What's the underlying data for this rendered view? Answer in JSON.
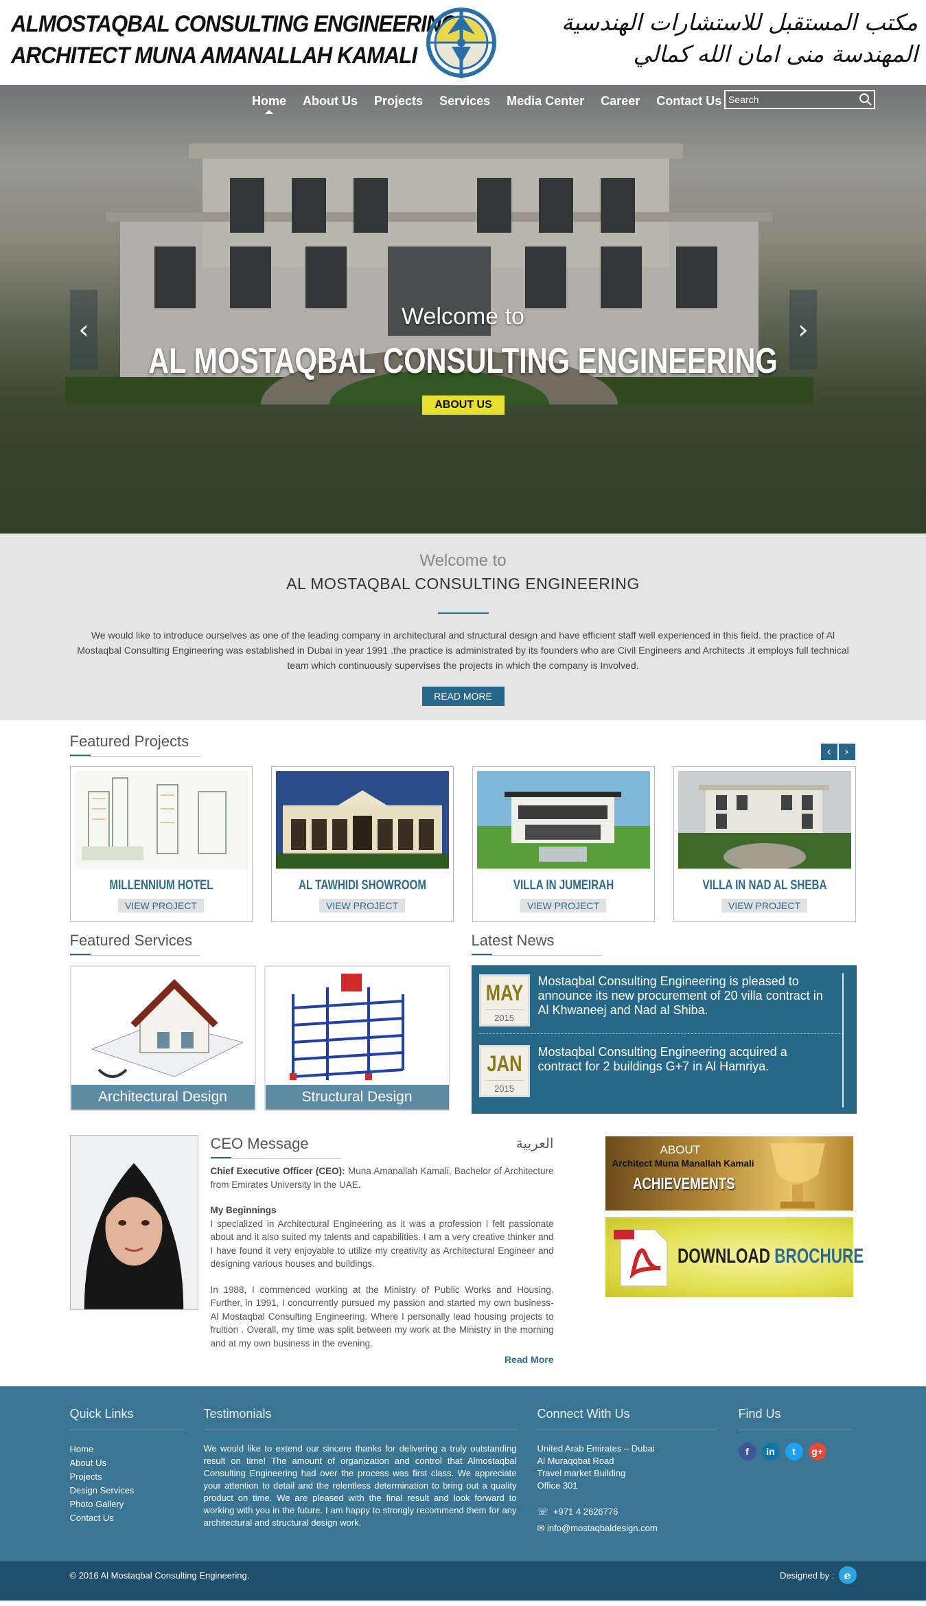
{
  "header": {
    "brand_en_line1": "ALMOSTAQBAL CONSULTING ENGINEERING",
    "brand_en_line2": "ARCHITECT MUNA AMANALLAH KAMALI",
    "brand_ar_line1": "مكتب المستقبل للاستشارات الهندسية",
    "brand_ar_line2": "المهندسة منى امان الله كمالي"
  },
  "nav": {
    "items": [
      "Home",
      "About Us",
      "Projects",
      "Services",
      "Media Center",
      "Career",
      "Contact Us"
    ],
    "active": "Home",
    "search_placeholder": "Search"
  },
  "hero": {
    "welcome": "Welcome to",
    "title": "AL MOSTAQBAL CONSULTING ENGINEERING",
    "button": "ABOUT US",
    "prev_glyph": "‹",
    "next_glyph": "›"
  },
  "welcome": {
    "subtitle": "Welcome to",
    "title": "AL MOSTAQBAL CONSULTING ENGINEERING",
    "body": "We would like to introduce ourselves as one of the leading company in architectural and structural design and have efficient staff well experienced in this field. the practice of Al Mostaqbal Consulting Engineering was established in Dubai in year 1991 .the practice is administrated by its founders who are Civil Engineers and Architects .it employs full technical team which continuously supervises the projects in which the company is Involved.",
    "button": "READ MORE"
  },
  "featured_projects": {
    "title": "Featured Projects",
    "prev": "‹",
    "next": "›",
    "button_label": "VIEW PROJECT",
    "items": [
      "MILLENNIUM HOTEL",
      "AL TAWHIDI SHOWROOM",
      "VILLA IN JUMEIRAH",
      "VILLA IN NAD AL SHEBA"
    ]
  },
  "featured_services": {
    "title": "Featured Services",
    "items": [
      "Architectural Design",
      "Structural Design"
    ]
  },
  "latest_news": {
    "title": "Latest News",
    "items": [
      {
        "month": "MAY",
        "year": "2015",
        "text": "Mostaqbal Consulting Engineering is pleased to announce its new procurement of 20 villa contract in Al Khwaneej and Nad al Shiba."
      },
      {
        "month": "JAN",
        "year": "2015",
        "text": "Mostaqbal Consulting Engineering acquired a contract for 2 buildings G+7 in Al Hamriya."
      }
    ]
  },
  "ceo": {
    "title": "CEO Message",
    "arabic_link": "العربية",
    "intro_label": "Chief Executive Officer (CEO):",
    "intro_text": " Muna Amanallah Kamali, Bachelor of Architecture from Emirates University in the UAE.",
    "beginnings_label": "My Beginnings",
    "para1": "I specialized in Architectural Engineering as it was a profession I felt passionate about and it also suited my talents and capabilities. I am a very creative thinker and I have found it very enjoyable to utilize my creativity as Architectural Engineer and designing various houses and buildings.",
    "para2": "In 1988, I commenced working at the Ministry of Public Works and Housing. Further, in 1991, I concurrently pursued my passion and started my own business-Al Mostaqbal Consulting Engineering. Where I personally lead housing projects to fruition . Overall, my time was split between my work at the Ministry in the morning and at my own business in the evening.",
    "read_more": "Read More"
  },
  "banners": {
    "about": "ABOUT",
    "architect": "Architect Muna Manallah Kamali",
    "achievements": "ACHIEVEMENTS",
    "download": "DOWNLOAD",
    "brochure": "BROCHURE"
  },
  "footer": {
    "quick_links_title": "Quick Links",
    "quick_links": [
      "Home",
      "About Us",
      "Projects",
      "Design Services",
      "Photo Gallery",
      "Contact Us"
    ],
    "testimonials_title": "Testimonials",
    "testimonial": "We would like to extend our sincere thanks for delivering a truly outstanding result on time! The amount of organization and control that Almostaqbal Consulting Engineering had over the process was first class. We appreciate your attention to detail and the relentless determination to bring out a quality product on time. We are pleased with the final result and look forward to working with you in the future. I am happy to strongly recommend them for any architectural and structural design work.",
    "connect_title": "Connect With Us",
    "address": [
      "United Arab Emirates – Dubai",
      "Al Muraqqbat Road",
      "Travel market Building",
      "Office 301"
    ],
    "phone": "+971 4 2626776",
    "email": "info@mostaqbaldesign.com",
    "find_title": "Find Us",
    "social": [
      {
        "icon": "facebook-icon",
        "glyph": "f",
        "color": "#3b5998"
      },
      {
        "icon": "linkedin-icon",
        "glyph": "in",
        "color": "#0e76a8"
      },
      {
        "icon": "twitter-icon",
        "glyph": "t",
        "color": "#1da1f2"
      },
      {
        "icon": "google-plus-icon",
        "glyph": "g+",
        "color": "#dd4b39"
      }
    ],
    "copyright": "© 2016 Al Mostaqbal Consulting Engineering.",
    "designed_by": "Designed by :",
    "designer_logo": "e"
  },
  "colors": {
    "primary": "#276888",
    "footer": "#3b7594",
    "bottom_bar": "#1e4f6c",
    "hero_button": "#e8e030"
  }
}
